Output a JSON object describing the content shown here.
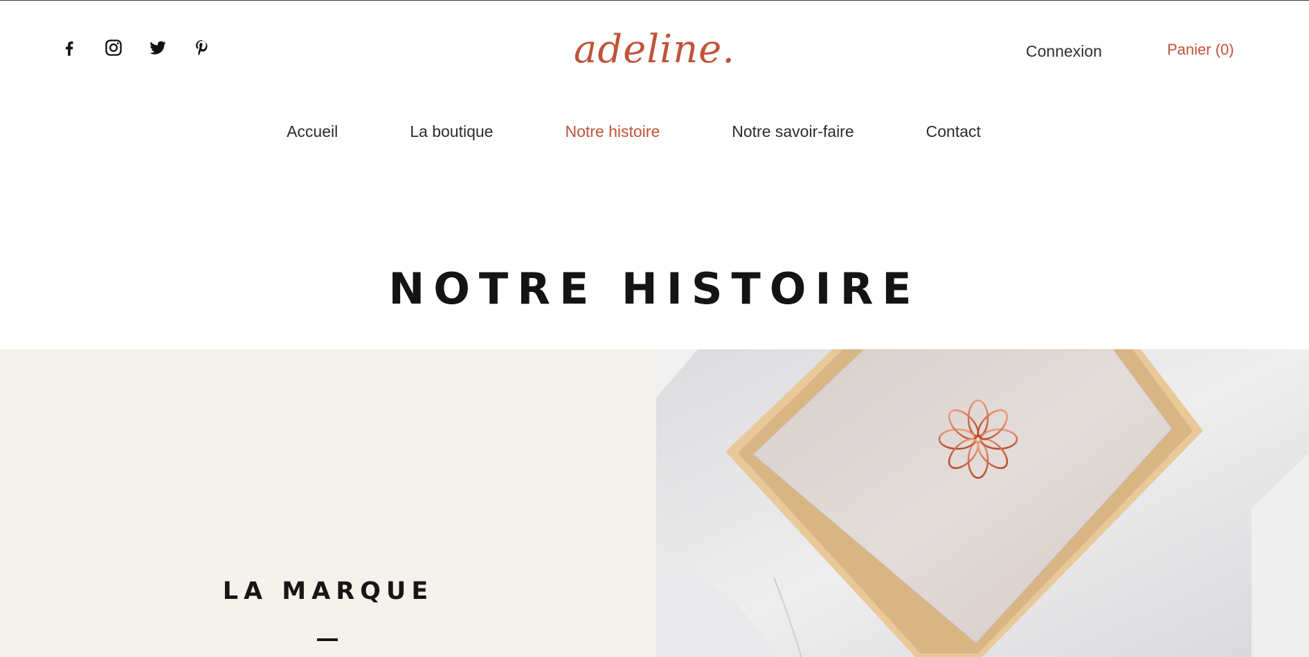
{
  "header": {
    "logo": "adeline.",
    "login_label": "Connexion",
    "cart_label": "Panier (0)",
    "socials": [
      {
        "icon": "facebook-icon"
      },
      {
        "icon": "instagram-icon"
      },
      {
        "icon": "twitter-icon"
      },
      {
        "icon": "pinterest-icon"
      }
    ]
  },
  "nav": {
    "items": [
      {
        "label": "Accueil",
        "active": false
      },
      {
        "label": "La boutique",
        "active": false
      },
      {
        "label": "Notre histoire",
        "active": true
      },
      {
        "label": "Notre savoir-faire",
        "active": false
      },
      {
        "label": "Contact",
        "active": false
      }
    ]
  },
  "main": {
    "title": "NOTRE HISTOIRE",
    "brand_heading": "LA MARQUE"
  },
  "colors": {
    "accent": "#c0533a",
    "text": "#2b2b2b",
    "panel_bg": "#f5f2ee"
  }
}
